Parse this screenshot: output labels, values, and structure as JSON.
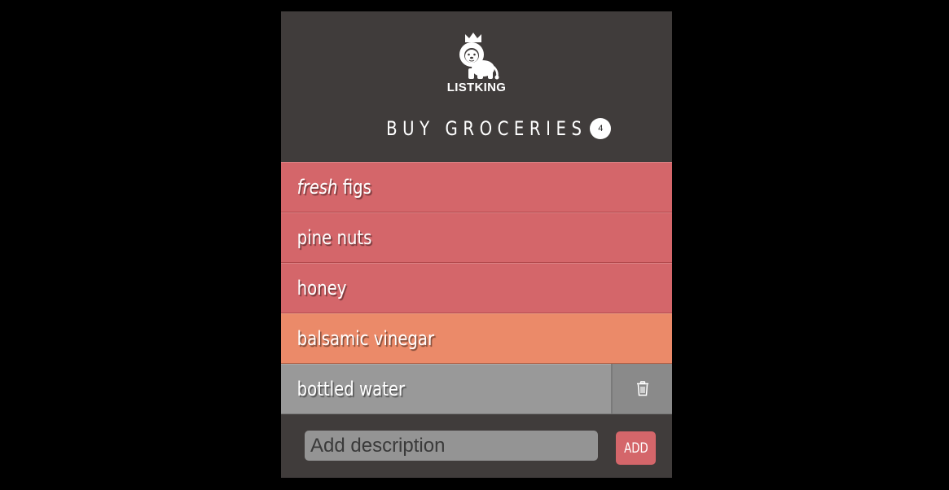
{
  "app": {
    "brand": "LISTKING",
    "list_title": "BUY GROCERIES",
    "item_count": "4"
  },
  "items": [
    {
      "prefix": "fresh",
      "label": " figs",
      "status": "pending",
      "color": "#d4666a"
    },
    {
      "prefix": "",
      "label": "pine nuts",
      "status": "pending",
      "color": "#d4666a"
    },
    {
      "prefix": "",
      "label": "honey",
      "status": "pending",
      "color": "#d4666a"
    },
    {
      "prefix": "",
      "label": "balsamic vinegar",
      "status": "highlighted",
      "color": "#eb8a69"
    },
    {
      "prefix": "",
      "label": "bottled water",
      "status": "done",
      "color": "#999999"
    }
  ],
  "icons": {
    "logo": "lion-crown-icon",
    "delete": "trash-icon"
  },
  "footer": {
    "input_placeholder": "Add description",
    "input_value": "",
    "add_label": "ADD"
  },
  "colors": {
    "background": "#403c3b",
    "item_red": "#d4666a",
    "item_orange": "#eb8a69",
    "item_grey": "#999999",
    "accent": "#d4666a"
  }
}
